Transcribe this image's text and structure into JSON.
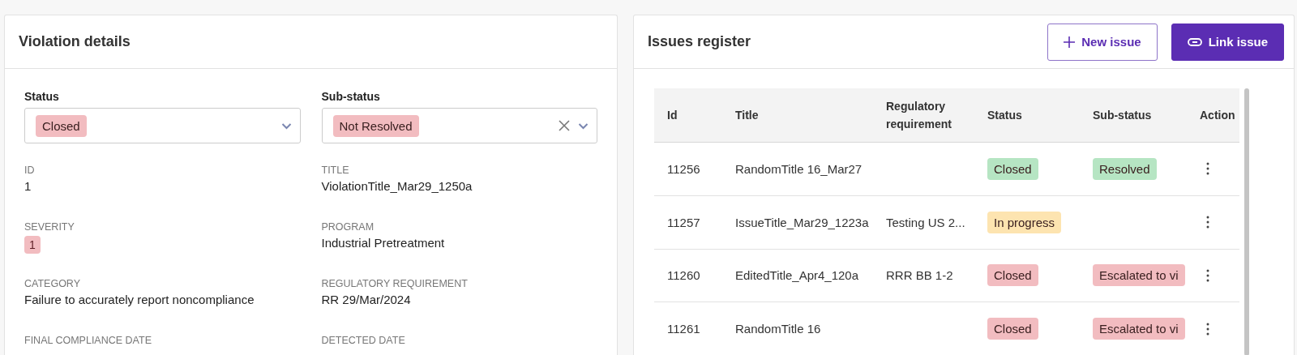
{
  "violation_details": {
    "title": "Violation details",
    "status": {
      "label": "Status",
      "value": "Closed",
      "color": "#f2bcc0",
      "clearable": false
    },
    "sub_status": {
      "label": "Sub-status",
      "value": "Not Resolved",
      "color": "#f2bcc0",
      "clearable": true
    },
    "fields": [
      {
        "label": "ID",
        "value": "1",
        "kind": "text"
      },
      {
        "label": "TITLE",
        "value": "ViolationTitle_Mar29_1250a",
        "kind": "text"
      },
      {
        "label": "SEVERITY",
        "value": "1",
        "kind": "badge"
      },
      {
        "label": "PROGRAM",
        "value": "Industrial Pretreatment",
        "kind": "text"
      },
      {
        "label": "CATEGORY",
        "value": "Failure to accurately report noncompliance",
        "kind": "text"
      },
      {
        "label": "REGULATORY REQUIREMENT",
        "value": "RR 29/Mar/2024",
        "kind": "text"
      },
      {
        "label": "FINAL COMPLIANCE DATE"
      },
      {
        "label": "DETECTED DATE"
      }
    ]
  },
  "issues_register": {
    "title": "Issues register",
    "buttons": [
      {
        "label": "New issue",
        "kind": "secondary"
      },
      {
        "label": "Link issue",
        "kind": "primary"
      }
    ],
    "table": {
      "columns": [
        "Id",
        "Title",
        "Regulatory requirement",
        "Status",
        "Sub-status",
        "Action"
      ],
      "rows": [
        {
          "id": "11256",
          "title": "RandomTitle 16_Mar27",
          "status": {
            "text": "Closed",
            "color": "#b6e5c3"
          },
          "sub_status": {
            "text": "Resolved",
            "color": "#b6e5c3"
          }
        },
        {
          "id": "11257",
          "title": "IssueTitle_Mar29_1223a",
          "requirement": "Testing US 2...",
          "status": {
            "text": "In progress",
            "color": "#fde4b0"
          }
        },
        {
          "id": "11260",
          "title": "EditedTitle_Apr4_120a",
          "requirement": "RRR BB 1-2",
          "status": {
            "text": "Closed",
            "color": "#f2bcc0"
          },
          "sub_status": {
            "text": "Escalated to vi",
            "color": "#f2bcc0"
          }
        },
        {
          "id": "11261",
          "title": "RandomTitle 16",
          "status": {
            "text": "Closed",
            "color": "#f2bcc0"
          },
          "sub_status": {
            "text": "Escalated to vi",
            "color": "#f2bcc0"
          }
        }
      ]
    }
  }
}
